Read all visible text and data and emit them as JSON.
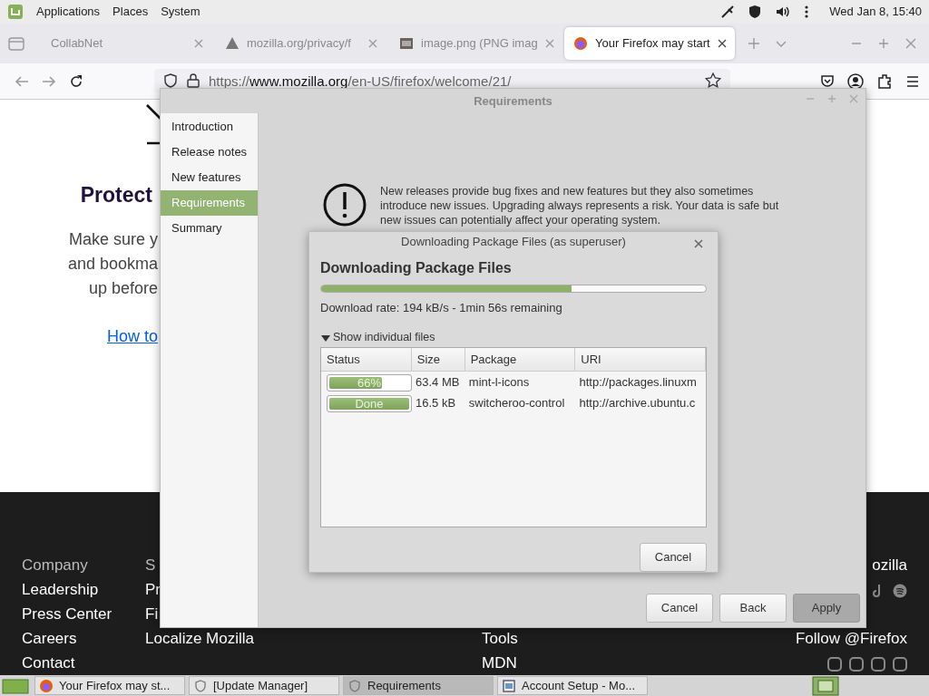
{
  "panel": {
    "menus": [
      "Applications",
      "Places",
      "System"
    ],
    "clock": "Wed Jan 8, 15:40"
  },
  "browser": {
    "tabs": [
      {
        "label": "CollabNet",
        "kind": "none",
        "selected": false
      },
      {
        "label": "mozilla.org/privacy/f",
        "kind": "warning",
        "selected": false
      },
      {
        "label": "image.png (PNG imag",
        "kind": "image",
        "selected": false
      },
      {
        "label": "Your Firefox may start",
        "kind": "firefox",
        "selected": true
      }
    ],
    "url": {
      "scheme": "https://",
      "host": "www.mozilla.org",
      "path": "/en-US/firefox/welcome/21/"
    }
  },
  "page": {
    "heading": "Protect",
    "lines": [
      "Make sure y",
      "and bookma",
      "up before"
    ],
    "link": "How to"
  },
  "footer": {
    "columns": [
      {
        "heading": "Company",
        "links": [
          "Leadership",
          "Press Center",
          "Careers",
          "Contact"
        ]
      },
      {
        "heading": "S",
        "links": [
          "Pr",
          "Fi",
          "Localize Mozilla"
        ]
      },
      {
        "links": [
          "Tools",
          "MDN"
        ]
      }
    ],
    "brand": "ozilla",
    "follow": "Follow @Firefox"
  },
  "requirements_window": {
    "title": "Requirements",
    "sidebar": [
      {
        "label": "Introduction",
        "selected": false
      },
      {
        "label": "Release notes",
        "selected": false
      },
      {
        "label": "New features",
        "selected": false
      },
      {
        "label": "Requirements",
        "selected": true
      },
      {
        "label": "Summary",
        "selected": false
      }
    ],
    "warning": "New releases provide bug fixes and new features but they also sometimes introduce new issues. Upgrading always represents a risk. Your data is safe but new issues can potentially affect your operating system.",
    "buttons": [
      {
        "label": "Cancel",
        "pressed": false
      },
      {
        "label": "Back",
        "pressed": false
      },
      {
        "label": "Apply",
        "pressed": true
      }
    ]
  },
  "download_dialog": {
    "title": "Downloading Package Files (as superuser)",
    "heading": "Downloading Package Files",
    "level": 0.65,
    "rate": "Download rate: 194 kB/s - 1min 56s remaining",
    "expander": {
      "label": "Show individual files",
      "expanded": true
    },
    "columns": [
      "Status",
      "Size",
      "Package",
      "URI"
    ],
    "rows": [
      {
        "status": "66%",
        "level": 0.66,
        "size": "63.4 MB",
        "package": "mint-l-icons",
        "uri": "http://packages.linuxm"
      },
      {
        "status": "Done",
        "level": 1,
        "size": "16.5 kB",
        "package": "switcheroo-control",
        "uri": "http://archive.ubuntu.c"
      }
    ],
    "button": "Cancel"
  },
  "taskbar": {
    "tasks": [
      {
        "label": "Your Firefox may st...",
        "kind": "firefox",
        "selected": false
      },
      {
        "label": "[Update Manager]",
        "kind": "shield",
        "selected": false
      },
      {
        "label": "Requirements",
        "kind": "shield",
        "selected": true
      },
      {
        "label": "Account Setup - Mo...",
        "kind": "window",
        "selected": false
      }
    ]
  }
}
